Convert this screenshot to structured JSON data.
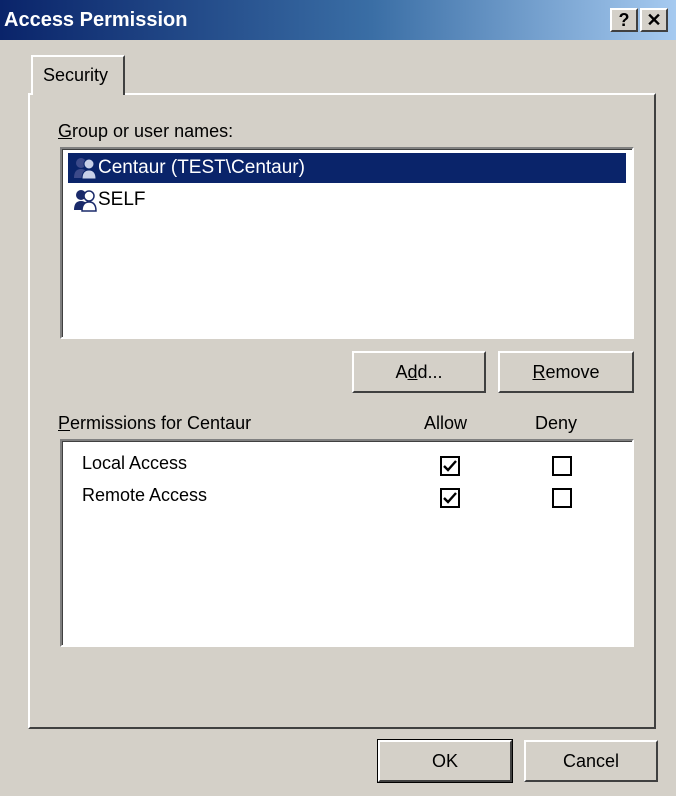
{
  "window": {
    "title": "Access Permission",
    "help_button": "?",
    "close_button": "✕"
  },
  "tabs": [
    {
      "label": "Security",
      "active": true
    }
  ],
  "groups": {
    "label": "Group or user names:",
    "mnemonic": "G",
    "items": [
      {
        "name": "Centaur (TEST\\Centaur)",
        "selected": true,
        "icon": "user-group-icon"
      },
      {
        "name": "SELF",
        "selected": false,
        "icon": "user-group-icon"
      }
    ]
  },
  "buttons": {
    "add": "Add...",
    "remove": "Remove",
    "ok": "OK",
    "cancel": "Cancel"
  },
  "permissions": {
    "label": "Permissions for Centaur",
    "allow_header": "Allow",
    "deny_header": "Deny",
    "rows": [
      {
        "name": "Local Access",
        "allow": true,
        "deny": false
      },
      {
        "name": "Remote Access",
        "allow": true,
        "deny": false
      }
    ]
  },
  "colors": {
    "face": "#d4d0c8",
    "selection": "#0a246a",
    "title_gradient_start": "#0a246a",
    "title_gradient_end": "#a6caf0"
  }
}
